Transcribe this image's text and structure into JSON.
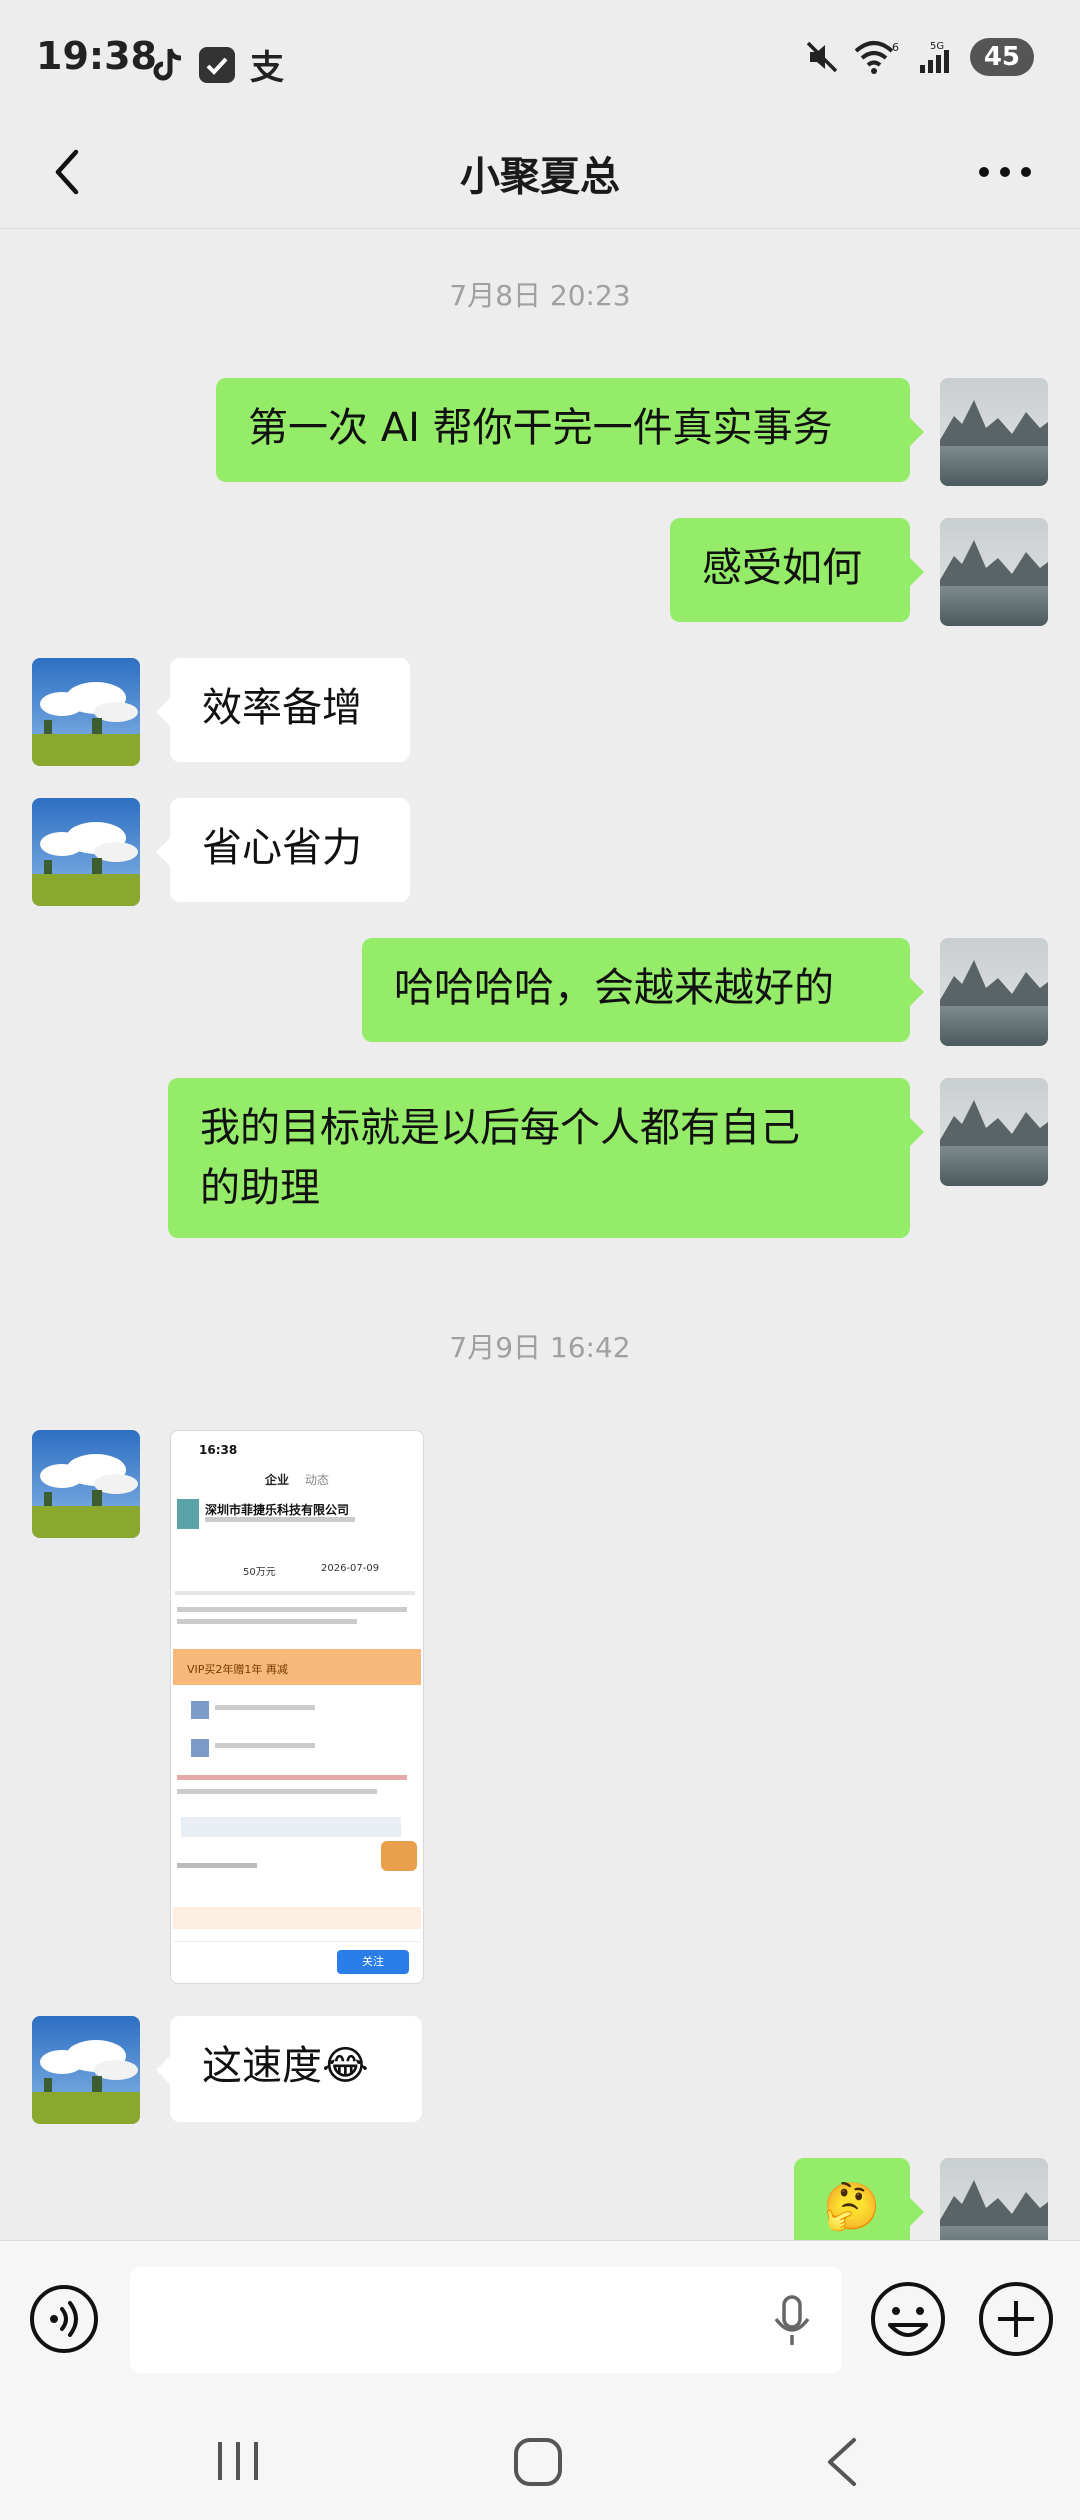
{
  "status_bar": {
    "time": "19:38",
    "app_icons": [
      "tiktok-icon",
      "check-icon",
      "alipay-icon"
    ],
    "alipay_glyph": "支",
    "battery": "45"
  },
  "header": {
    "title": "小聚夏总"
  },
  "messages": {
    "ts1": "7月8日 20:23",
    "m1": "第一次 AI 帮你干完一件真实事务",
    "m2": "感受如何",
    "m3": "效率备增",
    "m4": "省心省力",
    "m5": "哈哈哈哈，会越来越好的",
    "m6_line1": "我的目标就是以后每个人都有自己",
    "m6_line2": "的助理",
    "ts2": "7月9日 16:42",
    "m8": "这速度😂",
    "m9": "🤔"
  },
  "screenshot_message": {
    "time": "16:38",
    "tabs": [
      "企业",
      "动态"
    ],
    "company_name": "深圳市菲捷乐科技有限公司",
    "capital": "50万元",
    "date": "2026-07-09",
    "vip_banner": "VIP买2年赠1年 再减",
    "follow_label": "关注"
  },
  "colors": {
    "bg": "#ededed",
    "green_bubble": "#95ec69",
    "white_bubble": "#ffffff",
    "timestamp": "#a0a0a0"
  }
}
